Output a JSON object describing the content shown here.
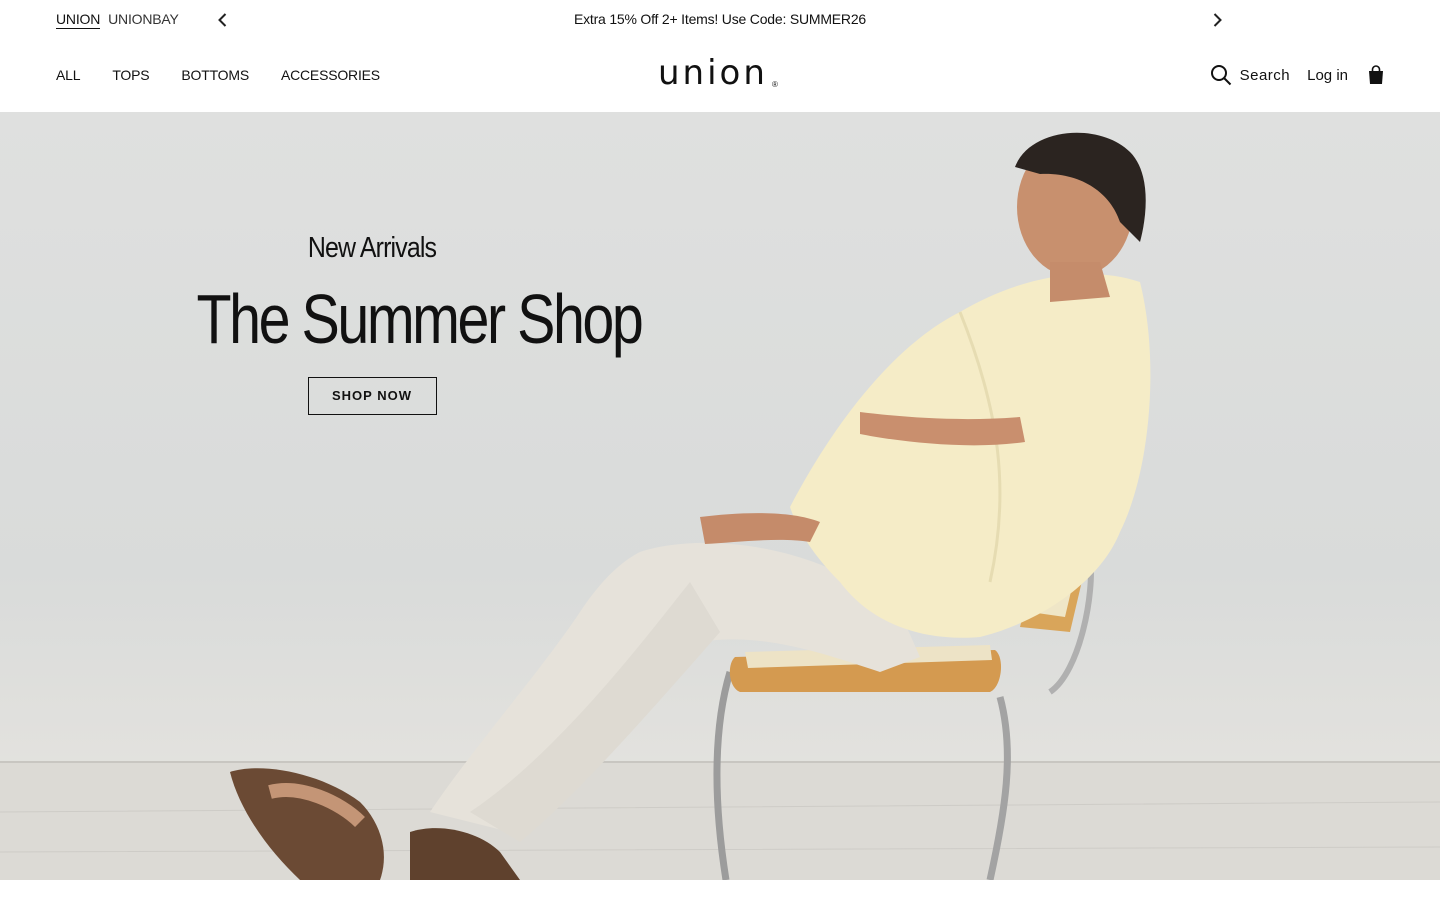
{
  "topbar": {
    "brands": [
      "UNION",
      "UNIONBAY"
    ],
    "active_brand": "UNION",
    "promo": "Extra 15% Off 2+ Items! Use Code: SUMMER26"
  },
  "header": {
    "nav": [
      "ALL",
      "TOPS",
      "BOTTOMS",
      "ACCESSORIES"
    ],
    "logo": "union",
    "logo_mark": "®",
    "search_label": "Search",
    "login_label": "Log in"
  },
  "hero": {
    "eyebrow": "New Arrivals",
    "title": "The Summer Shop",
    "cta": "SHOP NOW"
  },
  "icons": [
    "chevron-left-icon",
    "chevron-right-icon",
    "search-icon",
    "shopping-bag-icon"
  ]
}
